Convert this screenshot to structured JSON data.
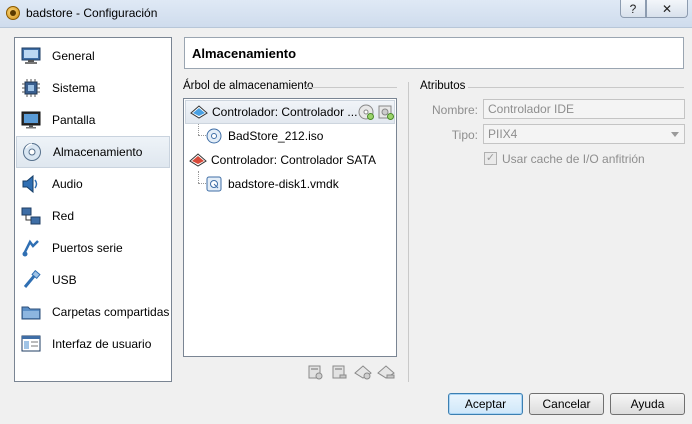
{
  "window": {
    "title": "badstore - Configuración",
    "help_label": "?",
    "close_label": "✕"
  },
  "sidebar": {
    "items": [
      {
        "label": "General",
        "icon": "monitor-icon"
      },
      {
        "label": "Sistema",
        "icon": "chip-icon"
      },
      {
        "label": "Pantalla",
        "icon": "display-icon"
      },
      {
        "label": "Almacenamiento",
        "icon": "disk-icon",
        "selected": true
      },
      {
        "label": "Audio",
        "icon": "speaker-icon"
      },
      {
        "label": "Red",
        "icon": "network-icon"
      },
      {
        "label": "Puertos serie",
        "icon": "serial-port-icon"
      },
      {
        "label": "USB",
        "icon": "usb-icon"
      },
      {
        "label": "Carpetas compartidas",
        "icon": "shared-folder-icon"
      },
      {
        "label": "Interfaz de usuario",
        "icon": "user-interface-icon"
      }
    ]
  },
  "main": {
    "title": "Almacenamiento",
    "tree_group_label": "Árbol de almacenamiento",
    "attributes_group_label": "Atributos",
    "tree": [
      {
        "label": "Controlador: Controlador ...",
        "type": "ide-controller",
        "selected": true
      },
      {
        "label": "BadStore_212.iso",
        "type": "optical-disk"
      },
      {
        "label": "Controlador: Controlador SATA",
        "type": "sata-controller"
      },
      {
        "label": "badstore-disk1.vmdk",
        "type": "hard-disk"
      }
    ],
    "attributes": {
      "name_label": "Nombre:",
      "name_value": "Controlador IDE",
      "type_label": "Tipo:",
      "type_value": "PIIX4",
      "cache_label": "Usar cache de I/O anfitrión",
      "cache_checked": true
    }
  },
  "buttons": {
    "accept": "Aceptar",
    "cancel": "Cancelar",
    "help": "Ayuda"
  },
  "colors": {
    "selection": "#dfe7ef",
    "window_bg": "#f0f0f0",
    "default_button": "#3c7fb1"
  }
}
